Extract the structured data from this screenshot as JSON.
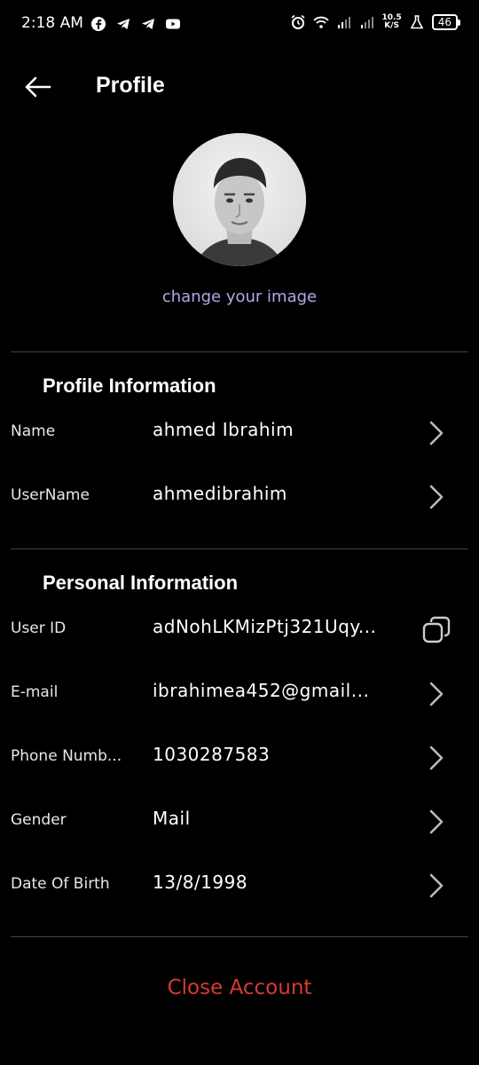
{
  "status_bar": {
    "time": "2:18 AM",
    "net_speed_value": "10.5",
    "net_speed_unit": "K/S",
    "battery": "46"
  },
  "header": {
    "title": "Profile"
  },
  "avatar": {
    "change_label": "change your image"
  },
  "profile_section": {
    "title": "Profile Information",
    "rows": [
      {
        "label": "Name",
        "value": "ahmed Ibrahim"
      },
      {
        "label": "UserName",
        "value": "ahmedibrahim"
      }
    ]
  },
  "personal_section": {
    "title": "Personal Information",
    "rows": [
      {
        "label": "User ID",
        "value": "adNohLKMizPtj321Uqy..."
      },
      {
        "label": "E-mail",
        "value": "ibrahimea452@gmail..."
      },
      {
        "label": "Phone Numb...",
        "value": "1030287583"
      },
      {
        "label": "Gender",
        "value": "Mail"
      },
      {
        "label": "Date Of Birth",
        "value": "13/8/1998"
      }
    ]
  },
  "footer": {
    "close_account_label": "Close Account",
    "close_account_color": "#d63a33"
  },
  "colors": {
    "background": "#000000",
    "accent_link": "#b8a4e8",
    "divider": "#444444"
  }
}
